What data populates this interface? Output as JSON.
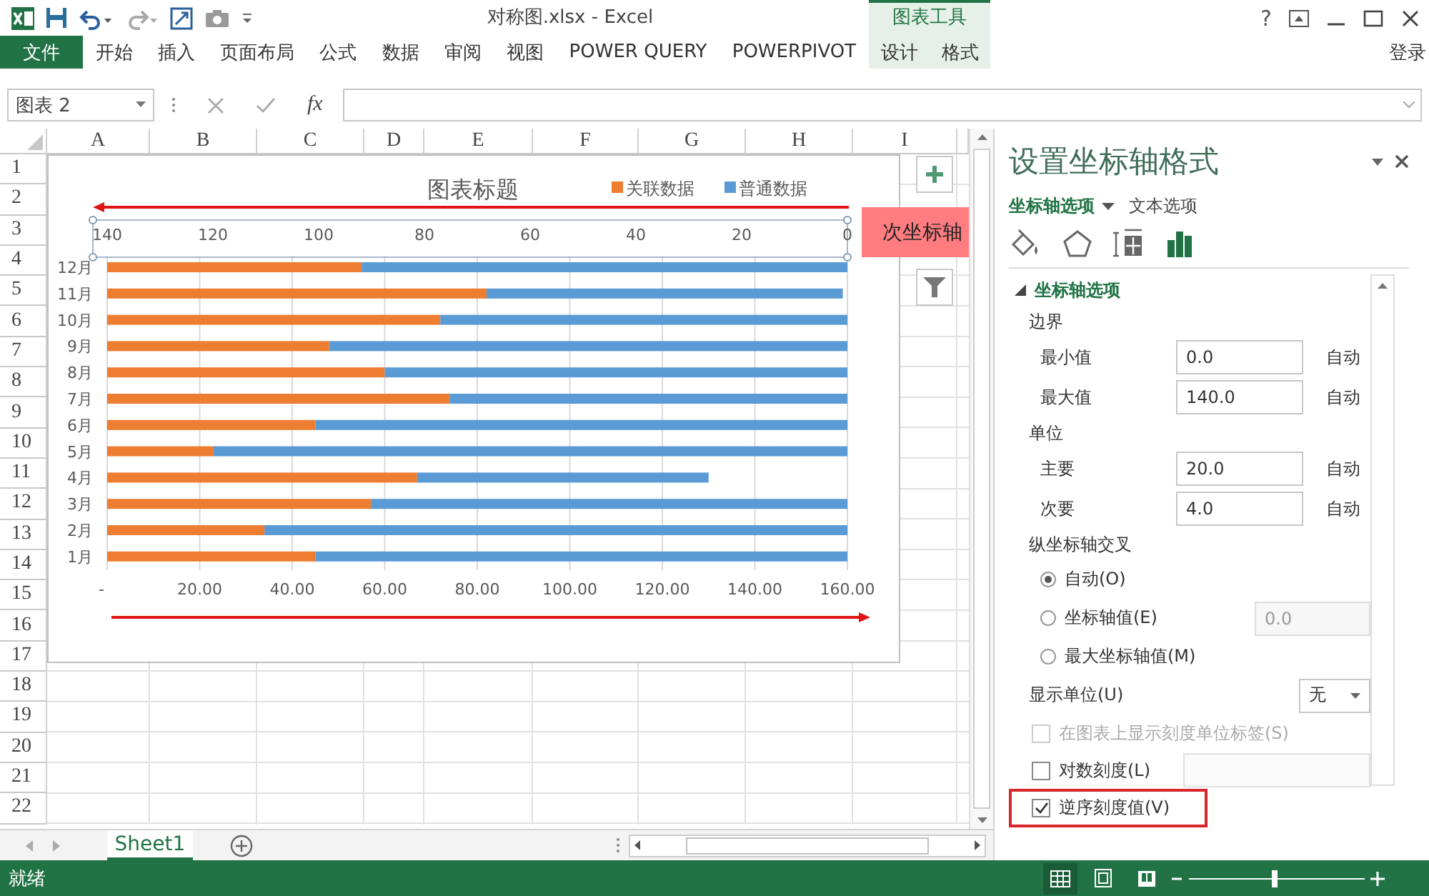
{
  "title_bar": {
    "title": "对称图.xlsx - Excel",
    "context_tab": "图表工具",
    "help": "?"
  },
  "ribbon": {
    "file_tab": "文件",
    "tabs": [
      {
        "label": "开始",
        "contextual": false
      },
      {
        "label": "插入",
        "contextual": false
      },
      {
        "label": "页面布局",
        "contextual": false
      },
      {
        "label": "公式",
        "contextual": false
      },
      {
        "label": "数据",
        "contextual": false
      },
      {
        "label": "审阅",
        "contextual": false
      },
      {
        "label": "视图",
        "contextual": false
      },
      {
        "label": "POWER QUERY",
        "contextual": false
      },
      {
        "label": "POWERPIVOT",
        "contextual": false
      },
      {
        "label": "设计",
        "contextual": true
      },
      {
        "label": "格式",
        "contextual": true
      }
    ],
    "sign_in": "登录"
  },
  "formula_bar": {
    "name_box": "图表 2",
    "function_label": "fx"
  },
  "sheet": {
    "columns": [
      "A",
      "B",
      "C",
      "D",
      "E",
      "F",
      "G",
      "H",
      "I"
    ],
    "rows": [
      "1",
      "2",
      "3",
      "4",
      "5",
      "6",
      "7",
      "8",
      "9",
      "10",
      "11",
      "12",
      "13",
      "14",
      "15",
      "16",
      "17",
      "18",
      "19",
      "20",
      "21",
      "22"
    ]
  },
  "chart": {
    "chart_data": {
      "type": "bar",
      "orientation": "horizontal",
      "stacked": true,
      "grid": true,
      "legend": "top",
      "title": "图表标题",
      "categories": [
        "12月",
        "11月",
        "10月",
        "9月",
        "8月",
        "7月",
        "6月",
        "5月",
        "4月",
        "3月",
        "2月",
        "1月"
      ],
      "series": [
        {
          "name": "关联数据",
          "color": "#ed7d31",
          "values": [
            55,
            82,
            72,
            48,
            60,
            74,
            45,
            23,
            67,
            57,
            34,
            45
          ]
        },
        {
          "name": "普通数据",
          "color": "#5b9bd5",
          "values": [
            105,
            77,
            88,
            112,
            100,
            86,
            115,
            137,
            63,
            103,
            126,
            115
          ]
        }
      ],
      "xlim": [
        0,
        160
      ],
      "xticks": [
        {
          "value": 0,
          "label": "-"
        },
        {
          "value": 20,
          "label": "20.00"
        },
        {
          "value": 40,
          "label": "40.00"
        },
        {
          "value": 60,
          "label": "60.00"
        },
        {
          "value": 80,
          "label": "80.00"
        },
        {
          "value": 100,
          "label": "100.00"
        },
        {
          "value": 120,
          "label": "120.00"
        },
        {
          "value": 140,
          "label": "140.00"
        },
        {
          "value": 160,
          "label": "160.00"
        }
      ]
    },
    "secondary_axis": {
      "ticks": [
        "140",
        "120",
        "100",
        "80",
        "60",
        "40",
        "20",
        "0"
      ]
    },
    "callout": "次坐标轴"
  },
  "format_pane": {
    "title": "设置坐标轴格式",
    "tabs": [
      {
        "label": "坐标轴选项",
        "selected": true
      },
      {
        "label": "文本选项",
        "selected": false
      }
    ],
    "icon_tabs": [
      {
        "kind": "fill",
        "selected": false
      },
      {
        "kind": "effects",
        "selected": false
      },
      {
        "kind": "size",
        "selected": false
      },
      {
        "kind": "options",
        "selected": true
      }
    ],
    "section": {
      "title": "坐标轴选项",
      "expanded": true
    },
    "items": [
      {
        "kind": "heading",
        "label": "边界"
      },
      {
        "kind": "field",
        "label": "最小值",
        "value": "0.0",
        "action": "自动"
      },
      {
        "kind": "field",
        "label": "最大值",
        "value": "140.0",
        "action": "自动"
      },
      {
        "kind": "heading",
        "label": "单位"
      },
      {
        "kind": "field",
        "label": "主要",
        "value": "20.0",
        "action": "自动"
      },
      {
        "kind": "field",
        "label": "次要",
        "value": "4.0",
        "action": "自动"
      },
      {
        "kind": "heading",
        "label": "纵坐标轴交叉"
      },
      {
        "kind": "radio",
        "label": "自动(O)",
        "selected": true
      },
      {
        "kind": "radio",
        "label": "坐标轴值(E)",
        "selected": false,
        "value": "0.0"
      },
      {
        "kind": "radio",
        "label": "最大坐标轴值(M)",
        "selected": false
      },
      {
        "kind": "dropdown",
        "label": "显示单位(U)",
        "value": "无"
      },
      {
        "kind": "checkbox",
        "label": "在图表上显示刻度单位标签(S)",
        "checked": false,
        "disabled": true,
        "field": false,
        "highlighted": false
      },
      {
        "kind": "checkbox",
        "label": "对数刻度(L)",
        "checked": false,
        "disabled": false,
        "field": true,
        "highlighted": false
      },
      {
        "kind": "checkbox",
        "label": "逆序刻度值(V)",
        "checked": true,
        "disabled": false,
        "field": false,
        "highlighted": true
      }
    ]
  },
  "sheet_tabs": [
    {
      "label": "Sheet1",
      "selected": true
    }
  ],
  "status_bar": {
    "text": "就绪"
  }
}
